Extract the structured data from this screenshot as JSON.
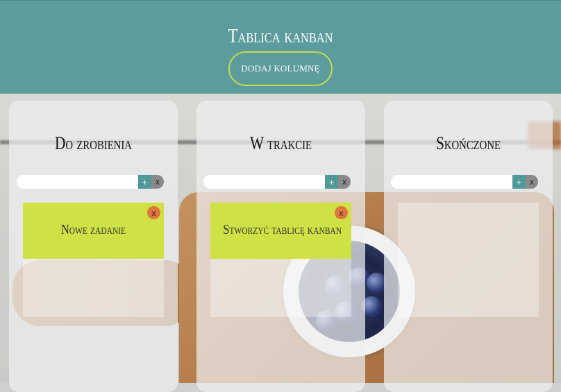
{
  "header": {
    "title": "Tablica kanban",
    "add_column_label": "DODAJ KOLUMNĘ"
  },
  "columns": [
    {
      "title": "Do zrobienia",
      "input_value": "",
      "add_label": "+",
      "clear_label": "x",
      "cards": [
        {
          "text": "Nowe zadanie",
          "delete_label": "x"
        }
      ]
    },
    {
      "title": "W trakcie",
      "input_value": "",
      "add_label": "+",
      "clear_label": "x",
      "cards": [
        {
          "text": "Stworzyć tablicę kanban",
          "delete_label": "x"
        }
      ]
    },
    {
      "title": "Skończone",
      "input_value": "",
      "add_label": "+",
      "clear_label": "x",
      "cards": []
    }
  ],
  "colors": {
    "header_bg": "#5c9c9c",
    "button_border": "#c5db4e",
    "card_bg": "#d0e145",
    "add_button": "#4f9a98",
    "delete_button": "#e0753d"
  }
}
